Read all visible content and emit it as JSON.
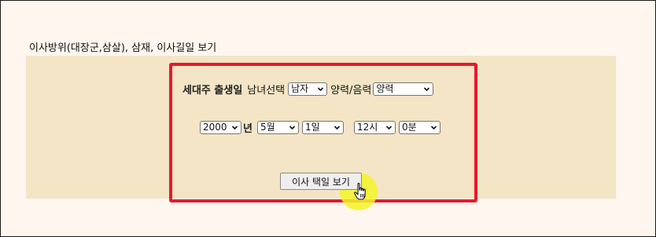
{
  "heading": "이사방위(대장군,삼살), 삼재, 이사길일 보기",
  "form": {
    "birth_label": "세대주 출생일",
    "gender_label": "남녀선택",
    "gender_value": "남자",
    "calendar_label": "양력/음력",
    "calendar_value": "양력",
    "year_value": "2000",
    "year_unit": "년",
    "month_value": "5월",
    "day_value": "1일",
    "hour_value": "12시",
    "minute_value": "0분",
    "submit_label": "이사 택일 보기"
  },
  "colors": {
    "page_bg": "#fff7ef",
    "panel_bg": "#f3e5c6",
    "highlight_border": "#e8192c",
    "cursor_glow": "#f5f528"
  },
  "icons": {
    "dropdown": "chevron-down-icon",
    "cursor": "hand-pointer-icon"
  }
}
